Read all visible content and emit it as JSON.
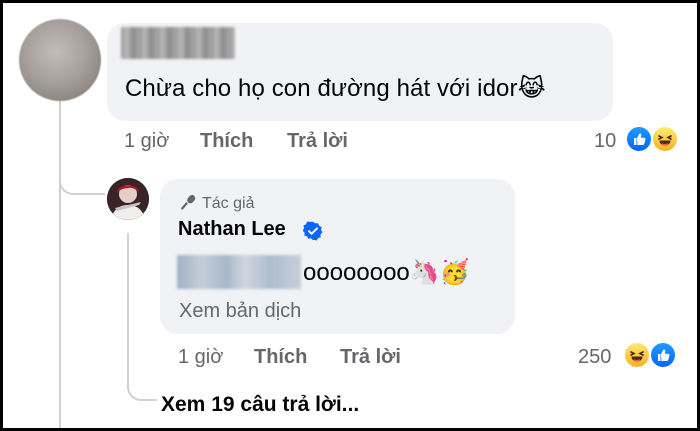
{
  "comment": {
    "text": "Chừa cho họ con đường hát với idor",
    "emoji": "😹",
    "time": "1 giờ",
    "like_label": "Thích",
    "reply_label": "Trả lời",
    "reaction_count": "10",
    "reaction_icons": [
      "like-icon",
      "haha-icon"
    ]
  },
  "reply": {
    "badge_label": "Tác giả",
    "author": "Nathan Lee",
    "text_suffix": "oooooooo",
    "emojis": "🦄🥳",
    "translate_label": "Xem bản dịch",
    "time": "1 giờ",
    "like_label": "Thích",
    "reply_label": "Trả lời",
    "reaction_count": "250",
    "reaction_icons": [
      "haha-icon",
      "like-icon"
    ]
  },
  "thread": {
    "see_replies_label": "Xem 19 câu trả lời..."
  },
  "colors": {
    "bubble": "#f0f2f5",
    "meta_text": "#65676b",
    "like_blue": "#0866ff",
    "haha_yellow": "#f7b125",
    "thread_line": "#ced0d4"
  }
}
